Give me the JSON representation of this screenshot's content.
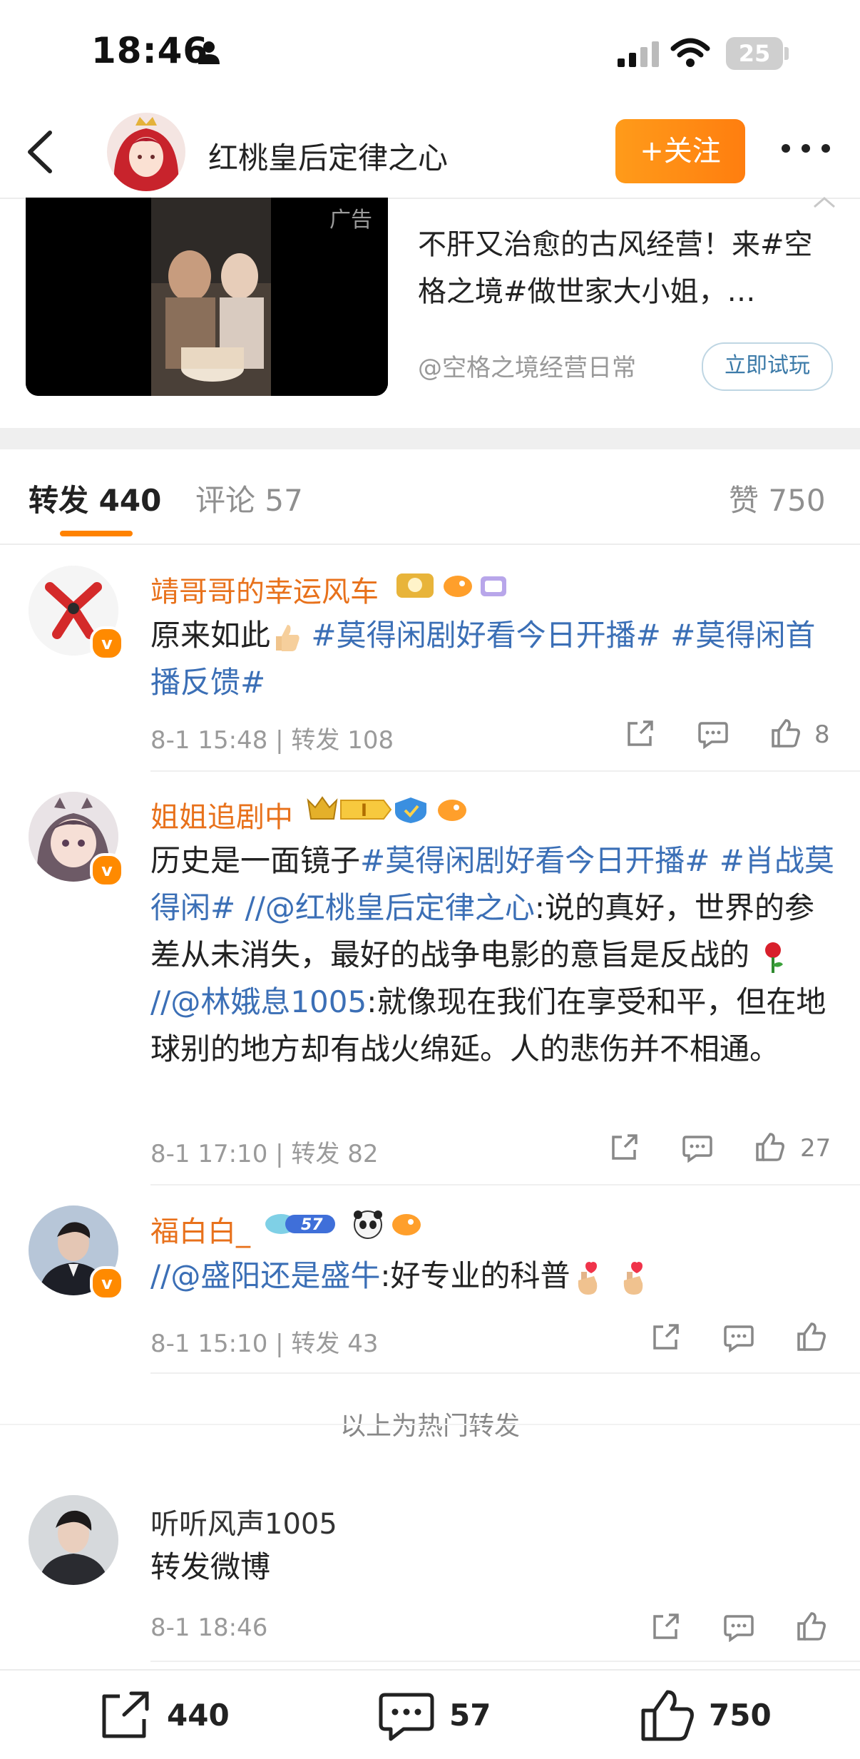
{
  "status_bar": {
    "time": "18:46",
    "battery": "25"
  },
  "header": {
    "title": "红桃皇后定律之心",
    "follow_label": "+关注"
  },
  "ad": {
    "badge": "广告",
    "text": "不肝又治愈的古风经营！来#空格之境#做世家大小姐，…",
    "source": "@空格之境经营日常",
    "cta": "立即试玩"
  },
  "tabs": {
    "repost_label": "转发",
    "repost_count": "440",
    "comment_label": "评论",
    "comment_count": "57",
    "like_label": "赞",
    "like_count": "750"
  },
  "posts": [
    {
      "user": "靖哥哥的幸运风车",
      "segments": [
        "原来如此",
        "#莫得闲剧好看今日开播#",
        "#莫得闲首播反馈#"
      ],
      "meta": "8-1 15:48 | 转发 108",
      "likes": "8"
    },
    {
      "user": "姐姐追剧中",
      "segments": [
        "历史是一面镜子",
        "#莫得闲剧好看今日开播#",
        "#肖战莫得闲#",
        "//",
        "@红桃皇后定律之心",
        ":说的真好，世界的参差从未消失，最好的战争电影的意旨是反战的",
        "//",
        "@林娥息1005",
        ":就像现在我们在享受和平，但在地球别的地方却有战火绵延。人的悲伤并不相通。"
      ],
      "meta": "8-1 17:10 | 转发 82",
      "likes": "27"
    },
    {
      "user": "福白白_",
      "level": "57",
      "segments": [
        "//",
        "@盛阳还是盛牛",
        ":好专业的科普"
      ],
      "meta": "8-1 15:10 | 转发 43",
      "likes": ""
    }
  ],
  "hot_label": "以上为热门转发",
  "latest_post": {
    "user": "听听风声1005",
    "text": "转发微博",
    "meta": "8-1 18:46"
  },
  "bottom_bar": {
    "repost_count": "440",
    "comment_count": "57",
    "like_count": "750"
  },
  "colors": {
    "accent": "#ff8200",
    "link": "#3b6fb6",
    "username": "#e8711b"
  }
}
